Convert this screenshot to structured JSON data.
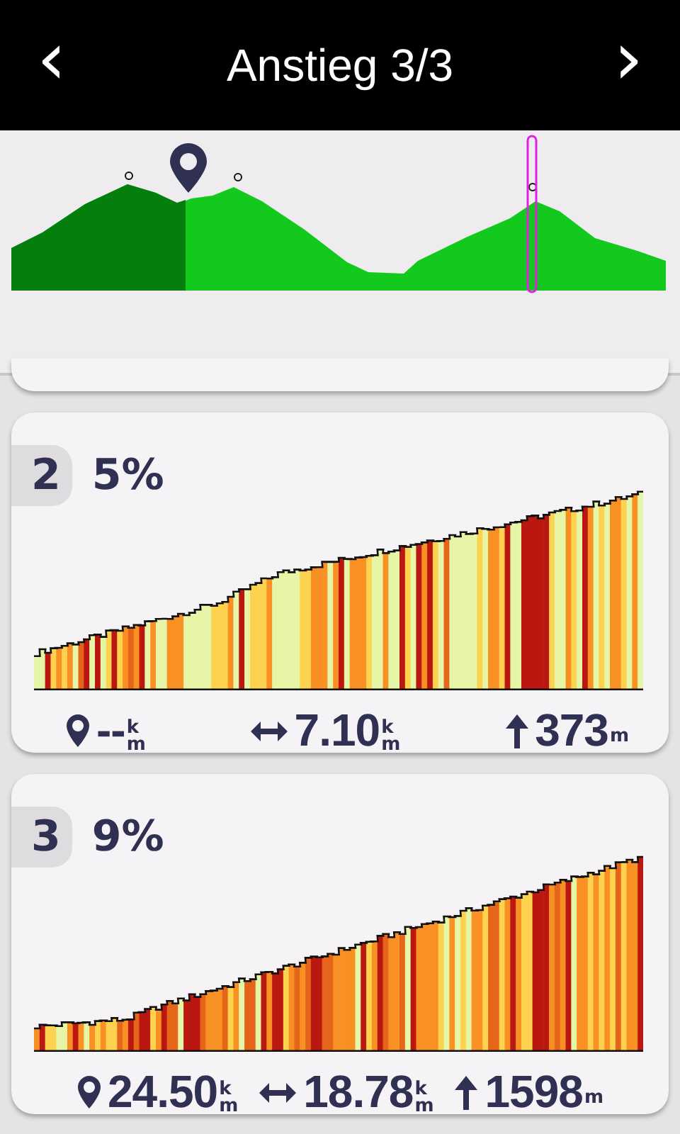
{
  "header": {
    "title": "Anstieg 3/3",
    "back": "‹",
    "forward": "›"
  },
  "climbs": [
    {
      "number": "2",
      "grade": "5%",
      "to_start": {
        "value": "--",
        "unit_top": "k",
        "unit_bottom": "m"
      },
      "length": {
        "value": "7.10",
        "unit_top": "k",
        "unit_bottom": "m"
      },
      "ascent": {
        "value": "373",
        "unit_bottom": "m"
      }
    },
    {
      "number": "3",
      "grade": "9%",
      "to_start": {
        "value": "24.50",
        "unit_top": "k",
        "unit_bottom": "m"
      },
      "length": {
        "value": "18.78",
        "unit_top": "k",
        "unit_bottom": "m"
      },
      "ascent": {
        "value": "1598",
        "unit_bottom": "m"
      }
    }
  ]
}
